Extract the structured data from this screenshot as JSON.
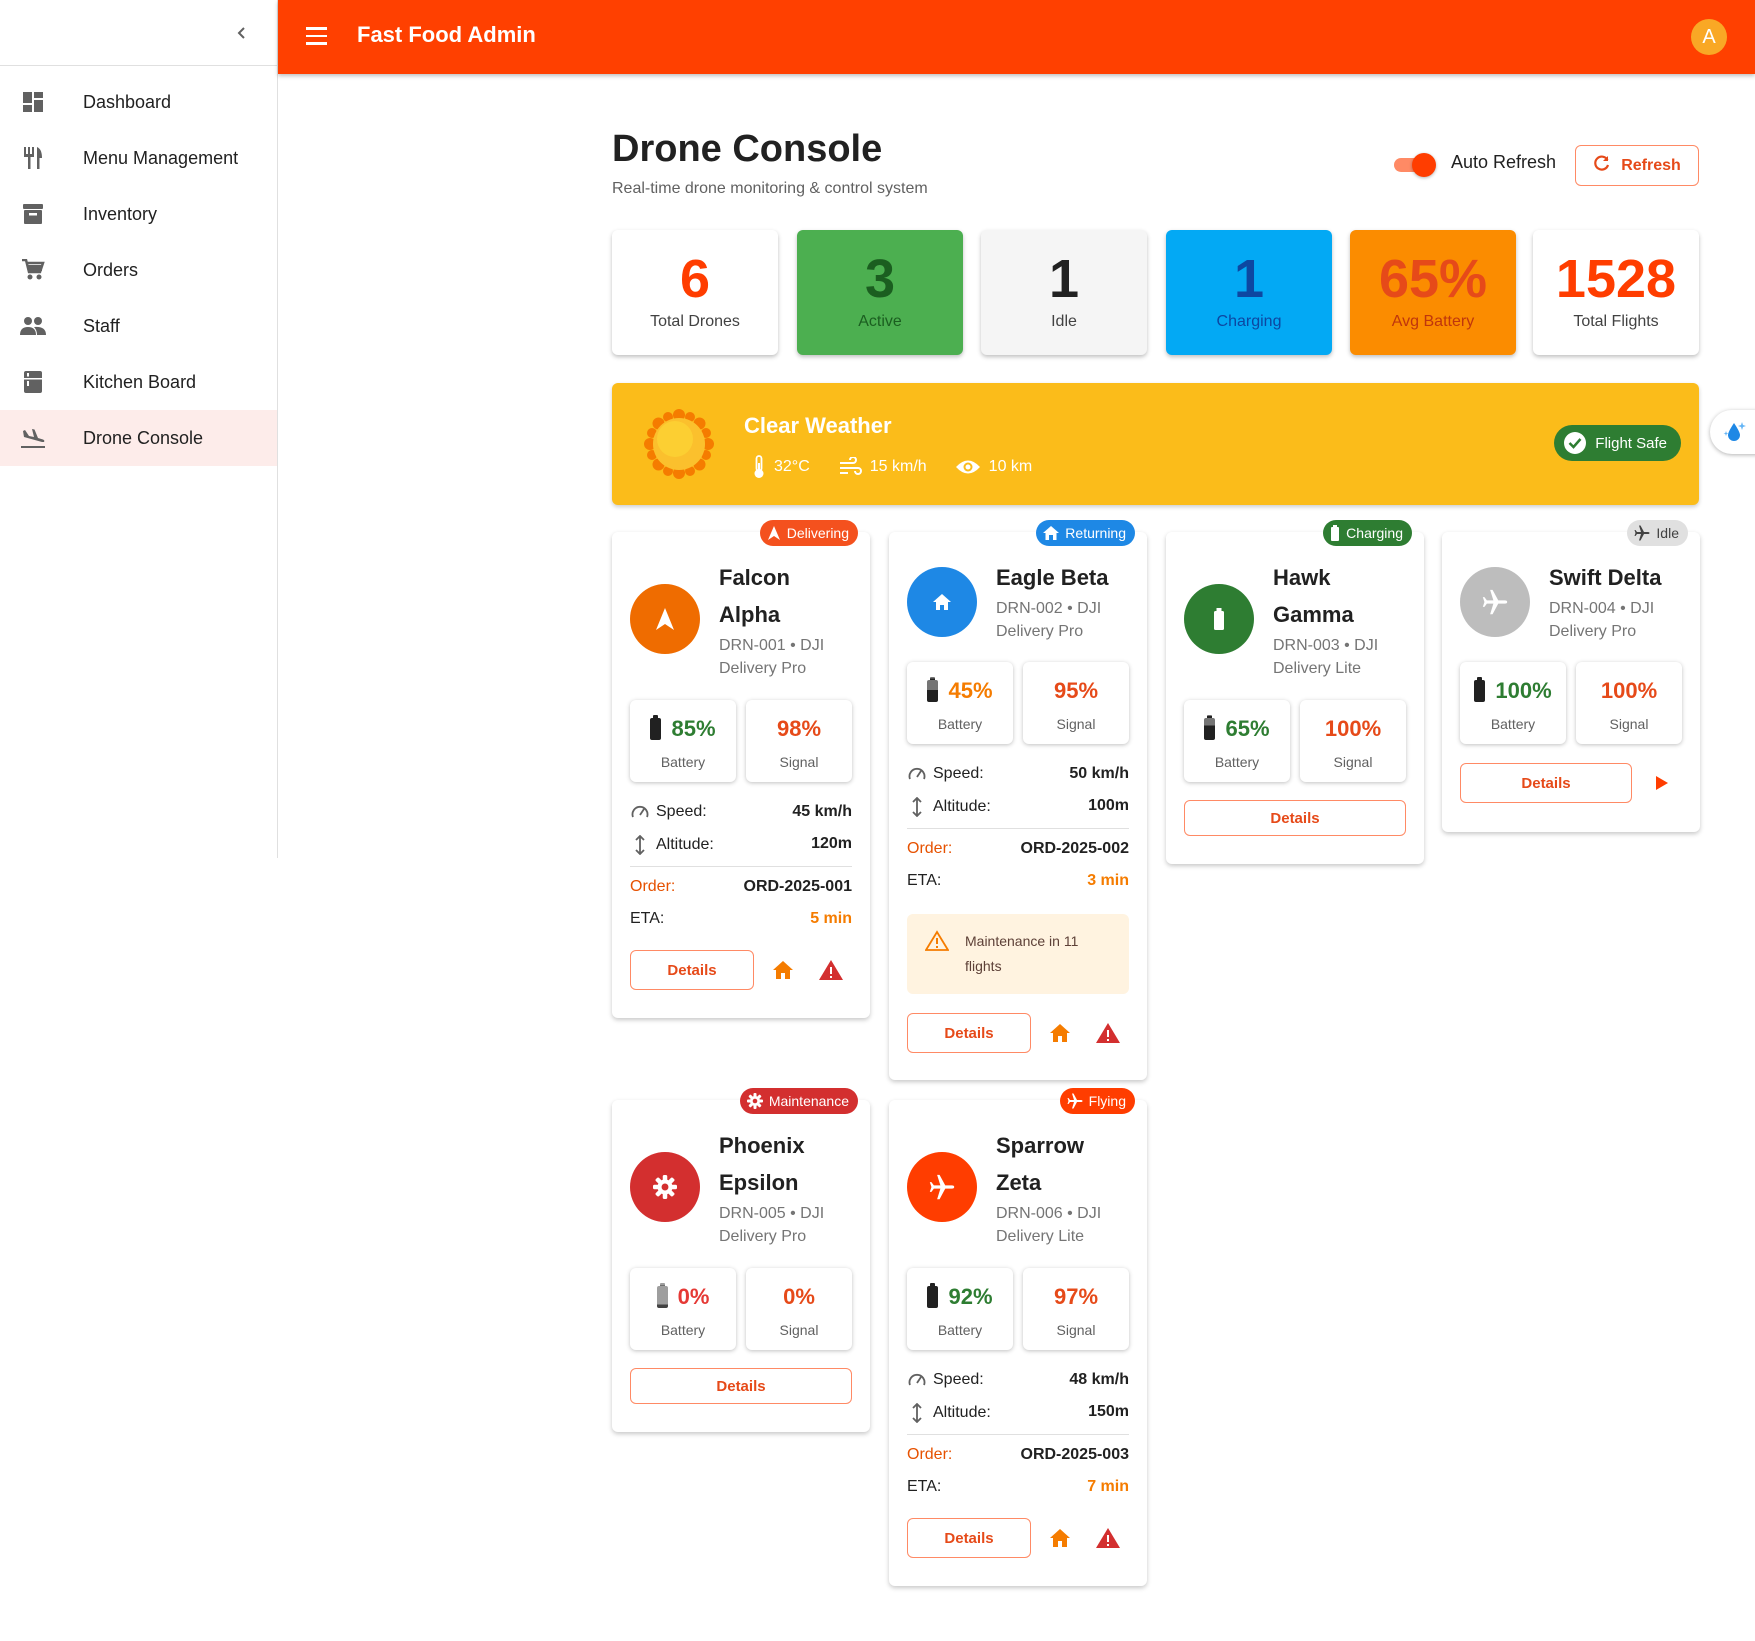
{
  "app": {
    "title": "Fast Food Admin",
    "avatar_letter": "A"
  },
  "sidebar": {
    "collapse_icon": "chevron-left-icon",
    "items": [
      {
        "label": "Dashboard",
        "icon": "dashboard-icon"
      },
      {
        "label": "Menu Management",
        "icon": "restaurant-icon"
      },
      {
        "label": "Inventory",
        "icon": "inventory-icon"
      },
      {
        "label": "Orders",
        "icon": "cart-icon"
      },
      {
        "label": "Staff",
        "icon": "people-icon"
      },
      {
        "label": "Kitchen Board",
        "icon": "kitchen-icon"
      },
      {
        "label": "Drone Console",
        "icon": "flight-land-icon",
        "active": true
      }
    ]
  },
  "page": {
    "title": "Drone Console",
    "subtitle": "Real-time drone monitoring & control system",
    "auto_refresh_label": "Auto Refresh",
    "auto_refresh_on": true,
    "refresh_label": "Refresh"
  },
  "stats": [
    {
      "value": "6",
      "label": "Total Drones"
    },
    {
      "value": "3",
      "label": "Active"
    },
    {
      "value": "1",
      "label": "Idle"
    },
    {
      "value": "1",
      "label": "Charging"
    },
    {
      "value": "65%",
      "label": "Avg Battery"
    },
    {
      "value": "1528",
      "label": "Total Flights"
    }
  ],
  "weather": {
    "title": "Clear Weather",
    "temperature": "32°C",
    "wind": "15 km/h",
    "visibility": "10 km",
    "status": "Flight Safe"
  },
  "labels": {
    "battery": "Battery",
    "signal": "Signal",
    "speed": "Speed:",
    "altitude": "Altitude:",
    "order": "Order:",
    "eta": "ETA:",
    "details": "Details"
  },
  "drones": [
    {
      "name_line1": "Falcon",
      "name_line2": "Alpha",
      "model_line1": "DRN-001 • DJI",
      "model_line2": "Delivery Pro",
      "status": "Delivering",
      "battery": "85%",
      "signal": "98%",
      "speed": "45 km/h",
      "altitude": "120m",
      "order": "ORD-2025-001",
      "eta": "5 min"
    },
    {
      "name_line1": "Eagle Beta",
      "model_line1": "DRN-002 • DJI",
      "model_line2": "Delivery Pro",
      "status": "Returning",
      "battery": "45%",
      "signal": "95%",
      "speed": "50 km/h",
      "altitude": "100m",
      "order": "ORD-2025-002",
      "eta": "3 min",
      "maintenance_line1": "Maintenance in 11",
      "maintenance_line2": "flights"
    },
    {
      "name_line1": "Hawk",
      "name_line2": "Gamma",
      "model_line1": "DRN-003 • DJI",
      "model_line2": "Delivery Lite",
      "status": "Charging",
      "battery": "65%",
      "signal": "100%"
    },
    {
      "name_line1": "Swift Delta",
      "model_line1": "DRN-004 • DJI",
      "model_line2": "Delivery Pro",
      "status": "Idle",
      "battery": "100%",
      "signal": "100%"
    },
    {
      "name_line1": "Phoenix",
      "name_line2": "Epsilon",
      "model_line1": "DRN-005 • DJI",
      "model_line2": "Delivery Pro",
      "status": "Maintenance",
      "battery": "0%",
      "signal": "0%"
    },
    {
      "name_line1": "Sparrow",
      "name_line2": "Zeta",
      "model_line1": "DRN-006 • DJI",
      "model_line2": "Delivery Lite",
      "status": "Flying",
      "battery": "92%",
      "signal": "97%",
      "speed": "48 km/h",
      "altitude": "150m",
      "order": "ORD-2025-003",
      "eta": "7 min"
    }
  ],
  "colors": {
    "primary": "#ff4000",
    "accent": "#e64a19",
    "success": "#2e7d32",
    "danger": "#d32f2f",
    "info": "#1e88e5",
    "warning": "#fbbc1a"
  }
}
